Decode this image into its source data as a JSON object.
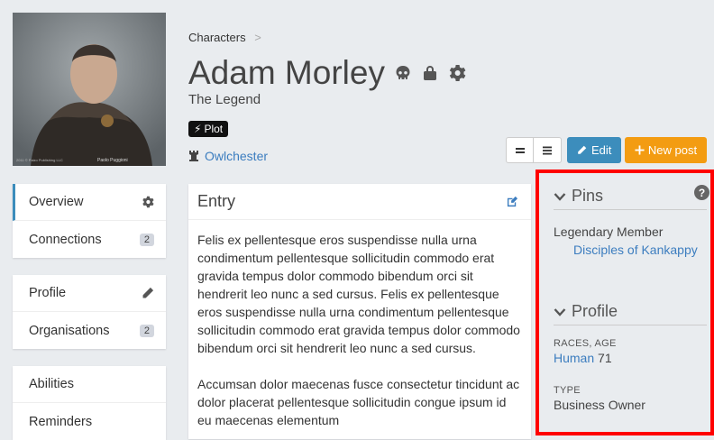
{
  "breadcrumb": {
    "root": "Characters",
    "separator": ">"
  },
  "header": {
    "title": "Adam Morley",
    "subtitle": "The Legend",
    "plot_badge": "Plot",
    "location": "Owlchester"
  },
  "portrait": {
    "signature": "Paolo Puggioni",
    "copyright": "2011 © Paizo Publishing LLC"
  },
  "actions": {
    "edit": "Edit",
    "new_post": "New post"
  },
  "menu_groups": [
    {
      "items": [
        {
          "label": "Overview"
        },
        {
          "label": "Connections",
          "count": "2"
        }
      ]
    },
    {
      "items": [
        {
          "label": "Profile"
        },
        {
          "label": "Organisations",
          "count": "2"
        }
      ]
    },
    {
      "items": [
        {
          "label": "Abilities"
        },
        {
          "label": "Reminders"
        }
      ]
    }
  ],
  "entry": {
    "title": "Entry",
    "paragraphs": [
      "Felis ex pellentesque eros suspendisse nulla urna condimentum pellentesque sollicitudin commodo erat gravida tempus dolor commodo bibendum orci sit hendrerit leo nunc a sed cursus. Felis ex pellentesque eros suspendisse nulla urna condimentum pellentesque sollicitudin commodo erat gravida tempus dolor commodo bibendum orci sit hendrerit leo nunc a sed cursus.",
      "Accumsan dolor maecenas fusce consectetur tincidunt ac dolor placerat pellentesque sollicitudin congue ipsum id eu maecenas elementum"
    ]
  },
  "pins": {
    "title": "Pins",
    "help": "?",
    "member_label": "Legendary Member",
    "member_link": "Disciples of Kankappy"
  },
  "profile": {
    "title": "Profile",
    "races_age_label": "RACES, AGE",
    "race": "Human",
    "age": "71",
    "type_label": "TYPE",
    "type": "Business Owner"
  },
  "colors": {
    "edit_button": "#3c8dbc",
    "new_post_button": "#f39c12",
    "link": "#3c7dbf",
    "highlight_border": "#ff0000"
  },
  "icons": [
    "skull-icon",
    "lock-icon",
    "gear-icon",
    "castle-icon",
    "pencil-icon",
    "plus-icon",
    "edit-icon",
    "help-icon",
    "chevron-down-icon"
  ]
}
